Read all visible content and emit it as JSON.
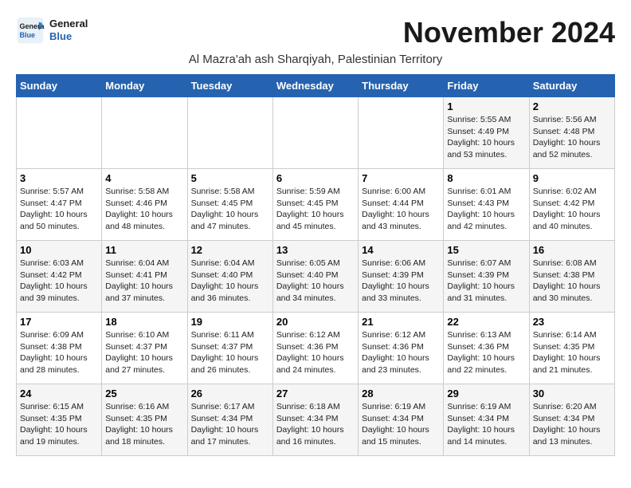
{
  "logo": {
    "line1": "General",
    "line2": "Blue"
  },
  "title": "November 2024",
  "subtitle": "Al Mazra'ah ash Sharqiyah, Palestinian Territory",
  "days_of_week": [
    "Sunday",
    "Monday",
    "Tuesday",
    "Wednesday",
    "Thursday",
    "Friday",
    "Saturday"
  ],
  "weeks": [
    [
      {
        "day": "",
        "info": ""
      },
      {
        "day": "",
        "info": ""
      },
      {
        "day": "",
        "info": ""
      },
      {
        "day": "",
        "info": ""
      },
      {
        "day": "",
        "info": ""
      },
      {
        "day": "1",
        "info": "Sunrise: 5:55 AM\nSunset: 4:49 PM\nDaylight: 10 hours\nand 53 minutes."
      },
      {
        "day": "2",
        "info": "Sunrise: 5:56 AM\nSunset: 4:48 PM\nDaylight: 10 hours\nand 52 minutes."
      }
    ],
    [
      {
        "day": "3",
        "info": "Sunrise: 5:57 AM\nSunset: 4:47 PM\nDaylight: 10 hours\nand 50 minutes."
      },
      {
        "day": "4",
        "info": "Sunrise: 5:58 AM\nSunset: 4:46 PM\nDaylight: 10 hours\nand 48 minutes."
      },
      {
        "day": "5",
        "info": "Sunrise: 5:58 AM\nSunset: 4:45 PM\nDaylight: 10 hours\nand 47 minutes."
      },
      {
        "day": "6",
        "info": "Sunrise: 5:59 AM\nSunset: 4:45 PM\nDaylight: 10 hours\nand 45 minutes."
      },
      {
        "day": "7",
        "info": "Sunrise: 6:00 AM\nSunset: 4:44 PM\nDaylight: 10 hours\nand 43 minutes."
      },
      {
        "day": "8",
        "info": "Sunrise: 6:01 AM\nSunset: 4:43 PM\nDaylight: 10 hours\nand 42 minutes."
      },
      {
        "day": "9",
        "info": "Sunrise: 6:02 AM\nSunset: 4:42 PM\nDaylight: 10 hours\nand 40 minutes."
      }
    ],
    [
      {
        "day": "10",
        "info": "Sunrise: 6:03 AM\nSunset: 4:42 PM\nDaylight: 10 hours\nand 39 minutes."
      },
      {
        "day": "11",
        "info": "Sunrise: 6:04 AM\nSunset: 4:41 PM\nDaylight: 10 hours\nand 37 minutes."
      },
      {
        "day": "12",
        "info": "Sunrise: 6:04 AM\nSunset: 4:40 PM\nDaylight: 10 hours\nand 36 minutes."
      },
      {
        "day": "13",
        "info": "Sunrise: 6:05 AM\nSunset: 4:40 PM\nDaylight: 10 hours\nand 34 minutes."
      },
      {
        "day": "14",
        "info": "Sunrise: 6:06 AM\nSunset: 4:39 PM\nDaylight: 10 hours\nand 33 minutes."
      },
      {
        "day": "15",
        "info": "Sunrise: 6:07 AM\nSunset: 4:39 PM\nDaylight: 10 hours\nand 31 minutes."
      },
      {
        "day": "16",
        "info": "Sunrise: 6:08 AM\nSunset: 4:38 PM\nDaylight: 10 hours\nand 30 minutes."
      }
    ],
    [
      {
        "day": "17",
        "info": "Sunrise: 6:09 AM\nSunset: 4:38 PM\nDaylight: 10 hours\nand 28 minutes."
      },
      {
        "day": "18",
        "info": "Sunrise: 6:10 AM\nSunset: 4:37 PM\nDaylight: 10 hours\nand 27 minutes."
      },
      {
        "day": "19",
        "info": "Sunrise: 6:11 AM\nSunset: 4:37 PM\nDaylight: 10 hours\nand 26 minutes."
      },
      {
        "day": "20",
        "info": "Sunrise: 6:12 AM\nSunset: 4:36 PM\nDaylight: 10 hours\nand 24 minutes."
      },
      {
        "day": "21",
        "info": "Sunrise: 6:12 AM\nSunset: 4:36 PM\nDaylight: 10 hours\nand 23 minutes."
      },
      {
        "day": "22",
        "info": "Sunrise: 6:13 AM\nSunset: 4:36 PM\nDaylight: 10 hours\nand 22 minutes."
      },
      {
        "day": "23",
        "info": "Sunrise: 6:14 AM\nSunset: 4:35 PM\nDaylight: 10 hours\nand 21 minutes."
      }
    ],
    [
      {
        "day": "24",
        "info": "Sunrise: 6:15 AM\nSunset: 4:35 PM\nDaylight: 10 hours\nand 19 minutes."
      },
      {
        "day": "25",
        "info": "Sunrise: 6:16 AM\nSunset: 4:35 PM\nDaylight: 10 hours\nand 18 minutes."
      },
      {
        "day": "26",
        "info": "Sunrise: 6:17 AM\nSunset: 4:34 PM\nDaylight: 10 hours\nand 17 minutes."
      },
      {
        "day": "27",
        "info": "Sunrise: 6:18 AM\nSunset: 4:34 PM\nDaylight: 10 hours\nand 16 minutes."
      },
      {
        "day": "28",
        "info": "Sunrise: 6:19 AM\nSunset: 4:34 PM\nDaylight: 10 hours\nand 15 minutes."
      },
      {
        "day": "29",
        "info": "Sunrise: 6:19 AM\nSunset: 4:34 PM\nDaylight: 10 hours\nand 14 minutes."
      },
      {
        "day": "30",
        "info": "Sunrise: 6:20 AM\nSunset: 4:34 PM\nDaylight: 10 hours\nand 13 minutes."
      }
    ]
  ]
}
